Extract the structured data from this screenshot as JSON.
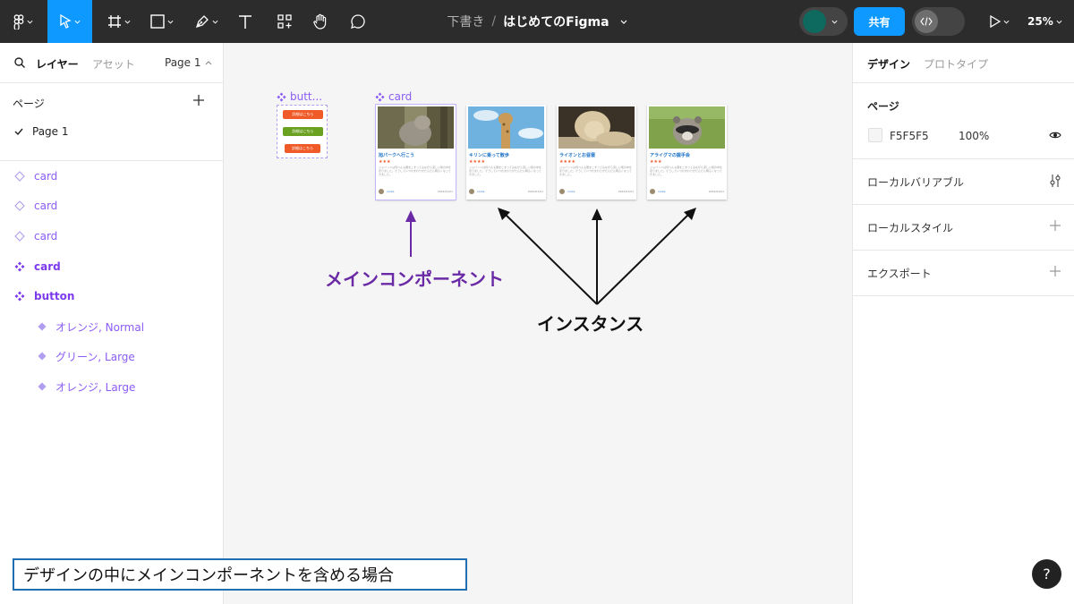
{
  "toolbar": {
    "draft_label": "下書き",
    "separator": "/",
    "file_name": "はじめてのFigma",
    "share_label": "共有",
    "zoom": "25%",
    "icons": [
      "figma-menu-icon",
      "move-tool-icon",
      "frame-tool-icon",
      "shape-tool-icon",
      "pen-tool-icon",
      "text-tool-icon",
      "resources-icon",
      "hand-tool-icon",
      "comment-icon",
      "present-icon",
      "dev-mode-icon"
    ],
    "accent_color": "#0d99ff"
  },
  "left_panel": {
    "tabs": {
      "layers": "レイヤー",
      "assets": "アセット",
      "page_selector": "Page 1"
    },
    "pages_title": "ページ",
    "pages": [
      {
        "label": "Page 1",
        "selected": true
      }
    ],
    "layers": [
      {
        "label": "card",
        "kind": "instance"
      },
      {
        "label": "card",
        "kind": "instance"
      },
      {
        "label": "card",
        "kind": "instance"
      },
      {
        "label": "card",
        "kind": "main-component"
      },
      {
        "label": "button",
        "kind": "component-set"
      },
      {
        "label": "オレンジ, Normal",
        "kind": "variant"
      },
      {
        "label": "グリーン, Large",
        "kind": "variant"
      },
      {
        "label": "オレンジ, Large",
        "kind": "variant"
      }
    ]
  },
  "canvas": {
    "button_frame_label": "butt...",
    "card_frame_label": "card",
    "buttons": [
      {
        "label": "詳細はこちら",
        "color": "#f05a28"
      },
      {
        "label": "詳細はこちら",
        "color": "#6aa121"
      },
      {
        "label": "詳細はこちら",
        "color": "#f05a28"
      }
    ],
    "cards": [
      {
        "title": "旭パークへ行こう",
        "stars": "★★★",
        "text": "ジョバンニは何べんも眼をこすってみながら涼しい風の中を走りました。そうしていつかまわりがだんだん明るくなってきました。",
        "author": "cocks",
        "date": "2024/01/01",
        "image": "cat-photo"
      },
      {
        "title": "キリンに乗って散歩",
        "stars": "★★★★",
        "text": "ジョバンニは何べんも眼をこすってみながら涼しい風の中を走りました。そうしていつかまわりがだんだん明るくなってきました。",
        "author": "cocks",
        "date": "2024/01/01",
        "image": "giraffe-photo"
      },
      {
        "title": "ライオンとお昼寝",
        "stars": "★★★★",
        "text": "ジョバンニは何べんも眼をこすってみながら涼しい風の中を走りました。そうしていつかまわりがだんだん明るくなってきました。",
        "author": "cocks",
        "date": "2024/01/01",
        "image": "lion-photo"
      },
      {
        "title": "アライグマの握手会",
        "stars": "★★★",
        "text": "ジョバンニは何べんも眼をこすってみながら涼しい風の中を走りました。そうしていつかまわりがだんだん明るくなってきました。",
        "author": "cocks",
        "date": "2024/01/01",
        "image": "raccoon-photo"
      }
    ],
    "annotation_main": "メインコンポーネント",
    "annotation_instance": "インスタンス"
  },
  "right_panel": {
    "tabs": {
      "design": "デザイン",
      "prototype": "プロトタイプ"
    },
    "page_section_title": "ページ",
    "bg_hex": "F5F5F5",
    "bg_opacity": "100%",
    "local_variables": "ローカルバリアブル",
    "local_styles": "ローカルスタイル",
    "export": "エクスポート"
  },
  "caption": "デザインの中にメインコンポーネントを含める場合",
  "help_label": "?"
}
